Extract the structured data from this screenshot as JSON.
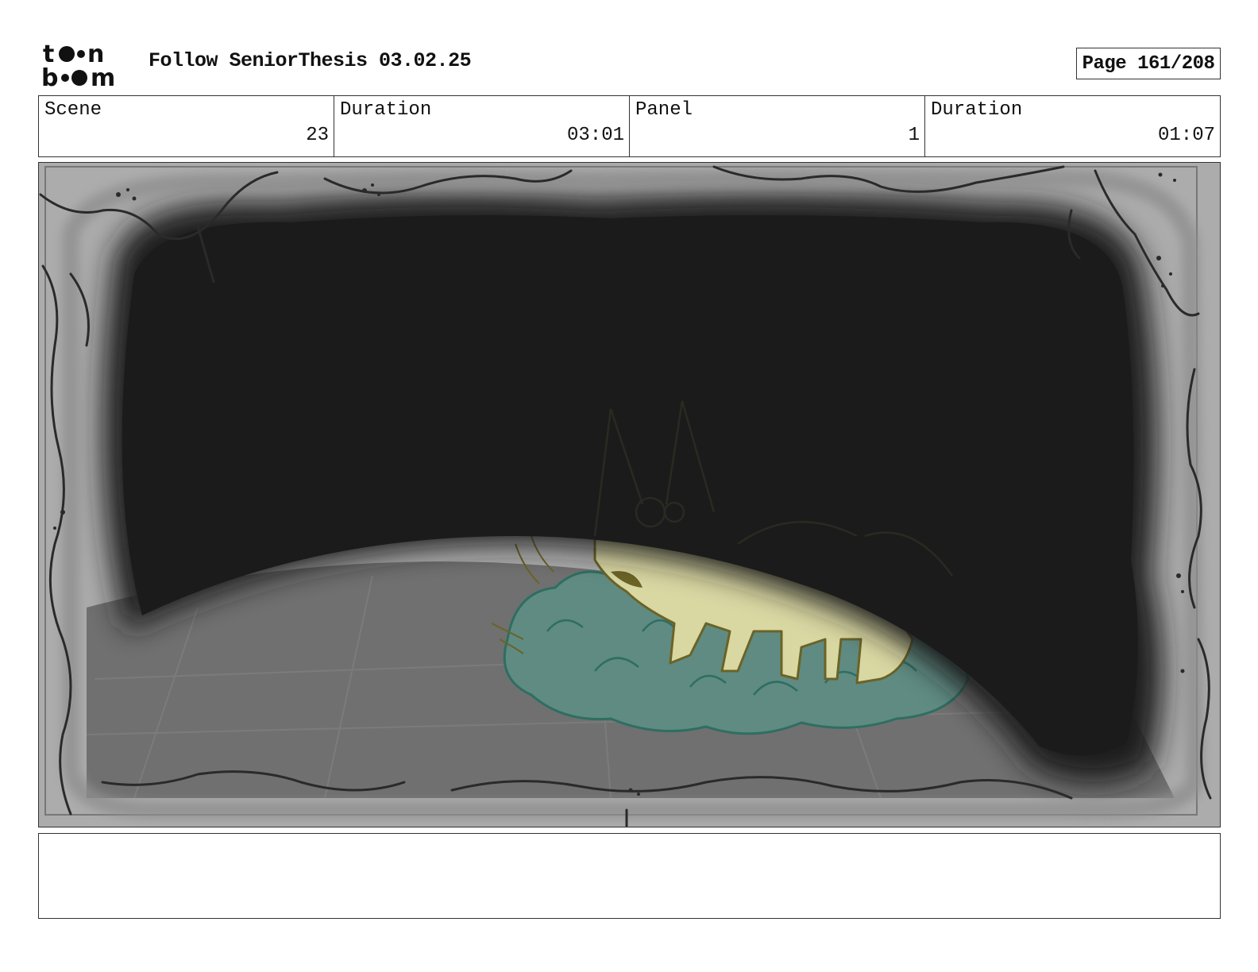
{
  "header": {
    "brand": "toon boom",
    "document_title": "Follow SeniorThesis 03.02.25",
    "page_label": "Page 161/208"
  },
  "info": {
    "scene_label": "Scene",
    "scene_value": "23",
    "scene_duration_label": "Duration",
    "scene_duration_value": "03:01",
    "panel_label": "Panel",
    "panel_value": "1",
    "panel_duration_label": "Duration",
    "panel_duration_value": "01:07"
  },
  "notes": {
    "text": ""
  },
  "colors": {
    "frame_gray": "#a9a9a9",
    "vignette": "#1c1c1c",
    "floor": "#6e6e6e",
    "bush": "#5e8a80",
    "bush_outline": "#2f6e62",
    "creature": "#d8d6a0",
    "creature_outline": "#6d6426"
  }
}
